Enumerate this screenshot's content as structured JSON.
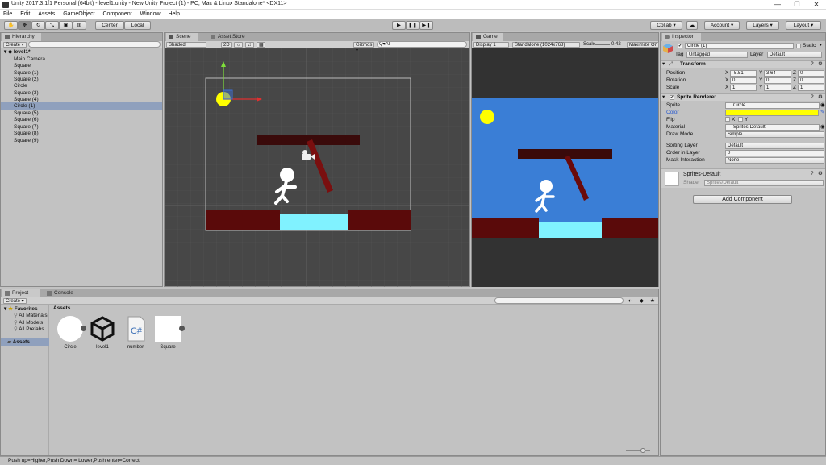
{
  "window": {
    "title": "Unity 2017.3.1f1 Personal (64bit) - level1.unity - New Unity Project (1) - PC, Mac & Linux Standalone* <DX11>",
    "controls": [
      "—",
      "❐",
      "✕"
    ]
  },
  "menu": [
    "File",
    "Edit",
    "Assets",
    "GameObject",
    "Component",
    "Window",
    "Help"
  ],
  "toolbar": {
    "pivot": "Center",
    "space": "Local",
    "collab": "Collab ▾",
    "account": "Account ▾",
    "layers": "Layers ▾",
    "layout": "Layout ▾"
  },
  "hierarchy": {
    "tab": "Hierarchy",
    "create": "Create ▾",
    "search_icon": "search-icon",
    "scene": "level1*",
    "items": [
      "Main Camera",
      "Square",
      "Square (1)",
      "Square (2)",
      "Circle",
      "Square (3)",
      "Square (4)",
      "Circle (1)",
      "Square (5)",
      "Square (6)",
      "Square (7)",
      "Square (8)",
      "Square (9)"
    ],
    "selected": "Circle (1)"
  },
  "scene_view": {
    "tab": "Scene",
    "tab2": "Asset Store",
    "shading": "Shaded",
    "mode_2d": "2D",
    "gizmos": "Gizmos ▾",
    "search_prefix": "Q▾All"
  },
  "game_view": {
    "tab": "Game",
    "display": "Display 1",
    "resolution": "Standalone (1024x768)",
    "scale_label": "Scale",
    "scale_value": "0.42",
    "maximize": "Maximize On"
  },
  "inspector": {
    "tab": "Inspector",
    "object_name": "Circle (1)",
    "static_label": "Static",
    "tag_label": "Tag",
    "tag_value": "Untagged",
    "layer_label": "Layer",
    "layer_value": "Default",
    "transform": {
      "title": "Transform",
      "position_label": "Position",
      "rotation_label": "Rotation",
      "scale_label": "Scale",
      "position": {
        "x": "-5.51",
        "y": "3.64",
        "z": "0"
      },
      "rotation": {
        "x": "0",
        "y": "0",
        "z": "0"
      },
      "scale": {
        "x": "1",
        "y": "1",
        "z": "1"
      }
    },
    "sprite_renderer": {
      "title": "Sprite Renderer",
      "sprite_label": "Sprite",
      "sprite_value": "Circle",
      "color_label": "Color",
      "flip_label": "Flip",
      "material_label": "Material",
      "material_value": "Sprites-Default",
      "draw_mode_label": "Draw Mode",
      "draw_mode_value": "Simple",
      "sorting_layer_label": "Sorting Layer",
      "sorting_layer_value": "Default",
      "order_label": "Order in Layer",
      "order_value": "0",
      "mask_label": "Mask Interaction",
      "mask_value": "None"
    },
    "material_block": {
      "name": "Sprites-Default",
      "shader_label": "Shader",
      "shader_value": "Sprites/Default"
    },
    "add_component": "Add Component"
  },
  "project": {
    "tab": "Project",
    "tab2": "Console",
    "create": "Create ▾",
    "favorites": "Favorites",
    "fav_items": [
      "All Materials",
      "All Models",
      "All Prefabs"
    ],
    "assets_folder": "Assets",
    "breadcrumb": "Assets",
    "assets": [
      {
        "name": "Circle",
        "icon": "circle-sprite-icon"
      },
      {
        "name": "level1",
        "icon": "unity-scene-icon"
      },
      {
        "name": "number",
        "icon": "csharp-script-icon"
      },
      {
        "name": "Square",
        "icon": "square-sprite-icon"
      }
    ]
  },
  "status": {
    "text": "Push up=Higher,Push Down= Lower,Push enter=Correct"
  },
  "colors": {
    "accent_selected": "#3d6fd6",
    "sprite_yellow": "#ffff00",
    "game_sky": "#3a7ed6",
    "dark_red": "#5a0a0a",
    "platform_cyan": "#80f2ff"
  }
}
